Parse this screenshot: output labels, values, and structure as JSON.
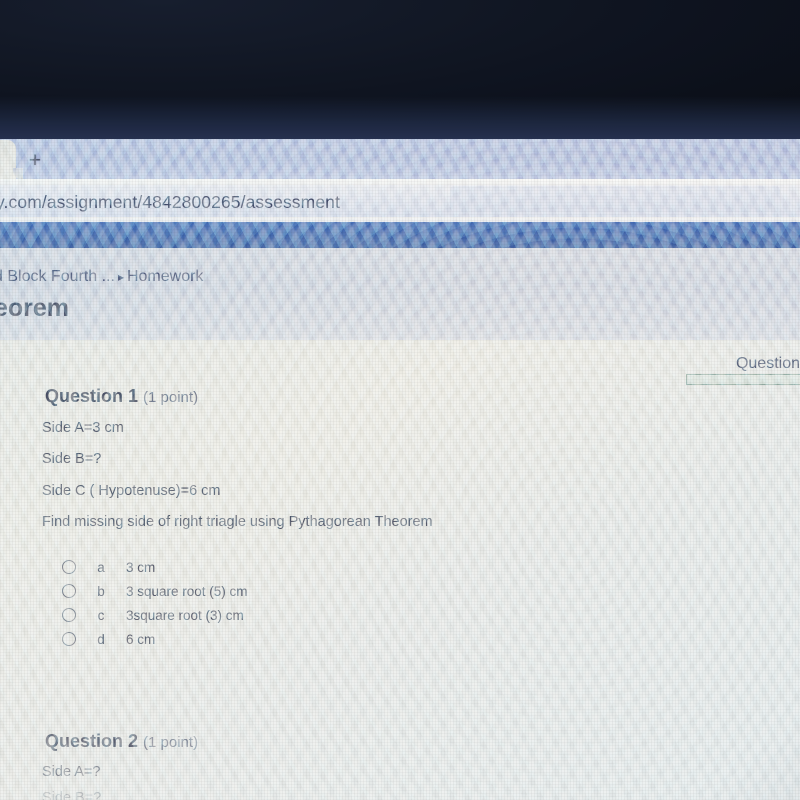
{
  "browser": {
    "new_tab_label": "+",
    "new_tab_icon": "plus-icon",
    "url": "y.com/assignment/4842800265/assessment"
  },
  "app_header": {
    "breadcrumb": {
      "parent": "d Block Fourth ...",
      "separator": "▸",
      "current": "Homework"
    },
    "page_title": "eorem"
  },
  "question_nav": {
    "label": "Question",
    "progress_percent": 0
  },
  "questions": [
    {
      "number_label": "Question 1",
      "points_label": "(1 point)",
      "prompt_lines": [
        "Side A=3 cm",
        "Side B=?",
        "Side C ( Hypotenuse)=6 cm",
        "Find missing side of right triagle using Pythagorean Theorem"
      ],
      "options": [
        {
          "letter": "a",
          "text": "3 cm",
          "selected": false
        },
        {
          "letter": "b",
          "text": "3 square root (5) cm",
          "selected": false
        },
        {
          "letter": "c",
          "text": "3square root (3) cm",
          "selected": false
        },
        {
          "letter": "d",
          "text": "6 cm",
          "selected": false
        }
      ]
    },
    {
      "number_label": "Question 2",
      "points_label": "(1 point)",
      "prompt_lines": [
        "Side A=?",
        "Side B=?"
      ],
      "options": []
    }
  ],
  "colors": {
    "app_bar_blue": "#1b49a8",
    "tab_strip": "#a7b2dd",
    "breadcrumb_band": "#c6cada",
    "content_bg": "#e3e2dc",
    "text_dark": "#1f2545",
    "link_blue": "#2a3464",
    "progress_outline": "#7e9a8f"
  }
}
